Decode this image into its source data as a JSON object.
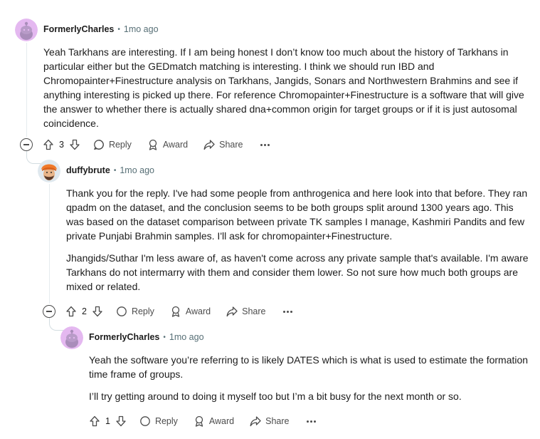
{
  "comments": [
    {
      "author": "FormerlyCharles",
      "separator": "•",
      "time": "1mo ago",
      "avatar_icon": "snoo-avatar-icon",
      "avatar_color": "#e4b8f0",
      "paragraphs": [
        "Yeah Tarkhans are interesting. If I am being honest I don’t know too much about the history of Tarkhans in particular either but the GEDmatch matching is interesting. I think we should run IBD and Chromopainter+Finestructure analysis on Tarkhans, Jangids, Sonars and Northwestern Brahmins and see if anything interesting is picked up there. For reference Chromopainter+Finestructure is a software that will give the answer to whether there is actually shared dna+common origin for target groups or if it is just autosomal coincidence."
      ],
      "votes": "3",
      "reply_label": "Reply",
      "award_label": "Award",
      "share_label": "Share"
    },
    {
      "author": "duffybrute",
      "separator": "•",
      "time": "1mo ago",
      "avatar_icon": "turban-avatar-icon",
      "paragraphs": [
        "Thank you for the reply. I've had some people from anthrogenica and here look into that before. They ran qpadm on the dataset, and the conclusion seems to be both groups split around 1300 years ago. This was based on the dataset comparison between private TK samples I manage, Kashmiri Pandits and few private Punjabi Brahmin samples. I'll ask for chromopainter+Finestructure.",
        "Jhangids/Suthar I'm less aware of, as haven't come across any private sample that's available. I'm aware Tarkhans do not intermarry with them and consider them lower. So not sure how much both groups are mixed or related."
      ],
      "votes": "2",
      "reply_label": "Reply",
      "award_label": "Award",
      "share_label": "Share"
    },
    {
      "author": "FormerlyCharles",
      "separator": "•",
      "time": "1mo ago",
      "avatar_icon": "snoo-avatar-icon",
      "avatar_color": "#e4b8f0",
      "paragraphs": [
        "Yeah the software you’re referring to is likely DATES which is what is used to estimate the formation time frame of groups.",
        "I’ll try getting around to doing it myself too but I’m a bit busy for the next month or so."
      ],
      "votes": "1",
      "reply_label": "Reply",
      "award_label": "Award",
      "share_label": "Share"
    }
  ]
}
